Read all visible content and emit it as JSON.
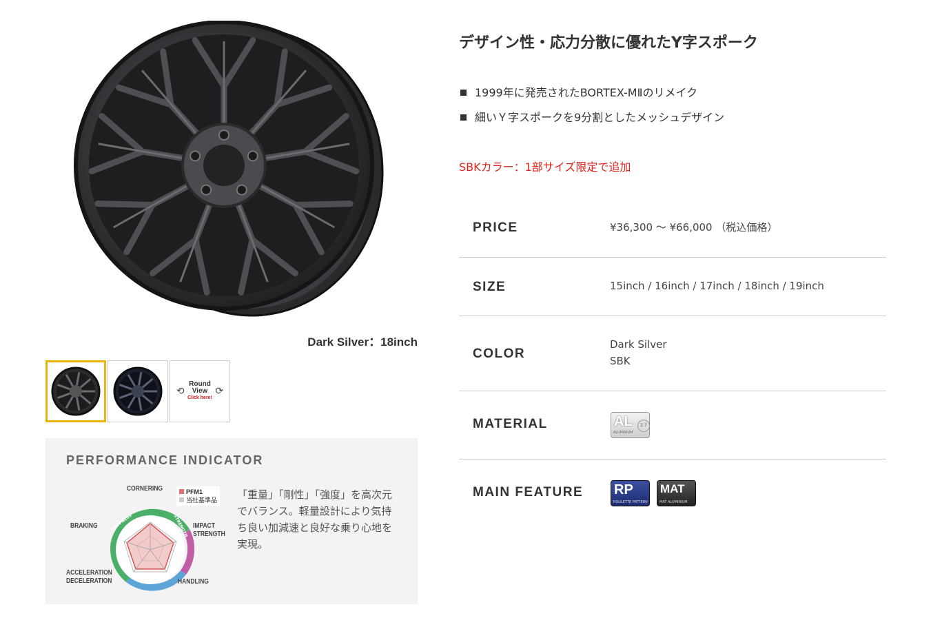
{
  "product": {
    "caption": "Dark Silver：18inch",
    "thumbnails": [
      {
        "name": "dark-silver",
        "selected": true
      },
      {
        "name": "sbk",
        "selected": false
      },
      {
        "name": "round-view",
        "title_line1": "Round",
        "title_line2": "View",
        "cta": "Click here!"
      }
    ]
  },
  "performance": {
    "title": "PERFORMANCE INDICATOR",
    "axes": {
      "cornering": "CORNERING",
      "impact_1": "IMPACT",
      "impact_2": "STRENGTH",
      "handling": "HANDLING",
      "accel_1": "ACCELERATION",
      "accel_2": "DECELERATION",
      "braking": "BRAKING"
    },
    "ring_labels": {
      "stiffness": "STIFFNESS",
      "strength": "STRENGTH",
      "weight": "WEIGHT"
    },
    "legend": {
      "pfm1": "PFM1",
      "standard": "当社基準品"
    },
    "description": "「重量」「剛性」「強度」を高次元でバランス。軽量設計により気持ち良い加減速と良好な乗り心地を実現。"
  },
  "headline": "デザイン性・応力分散に優れたY字スポーク",
  "features": [
    "1999年に発売されたBORTEX-MⅡのリメイク",
    "細いＹ字スポークを9分割としたメッシュデザイン"
  ],
  "sbk_note": "SBKカラー：1部サイズ限定で追加",
  "specs": {
    "price": {
      "label": "PRICE",
      "value": "¥36,300 ～ ¥66,000 （税込価格）"
    },
    "size": {
      "label": "SIZE",
      "value": "15inch / 16inch / 17inch / 18inch / 19inch"
    },
    "color": {
      "label": "COLOR",
      "values": [
        "Dark Silver",
        "SBK"
      ]
    },
    "material": {
      "label": "MATERIAL",
      "badge_text": "AL",
      "badge_sub": "ALUMINIUM",
      "badge_num": "2.7"
    },
    "main_feature": {
      "label": "MAIN FEATURE",
      "badges": [
        {
          "text": "RP",
          "sub": "ROULETTE PATTERN"
        },
        {
          "text": "MAT",
          "sub": "MAT ALUMINIUM"
        }
      ]
    }
  },
  "colors": {
    "accent": "#e8b50f",
    "note_red": "#e0241b"
  }
}
